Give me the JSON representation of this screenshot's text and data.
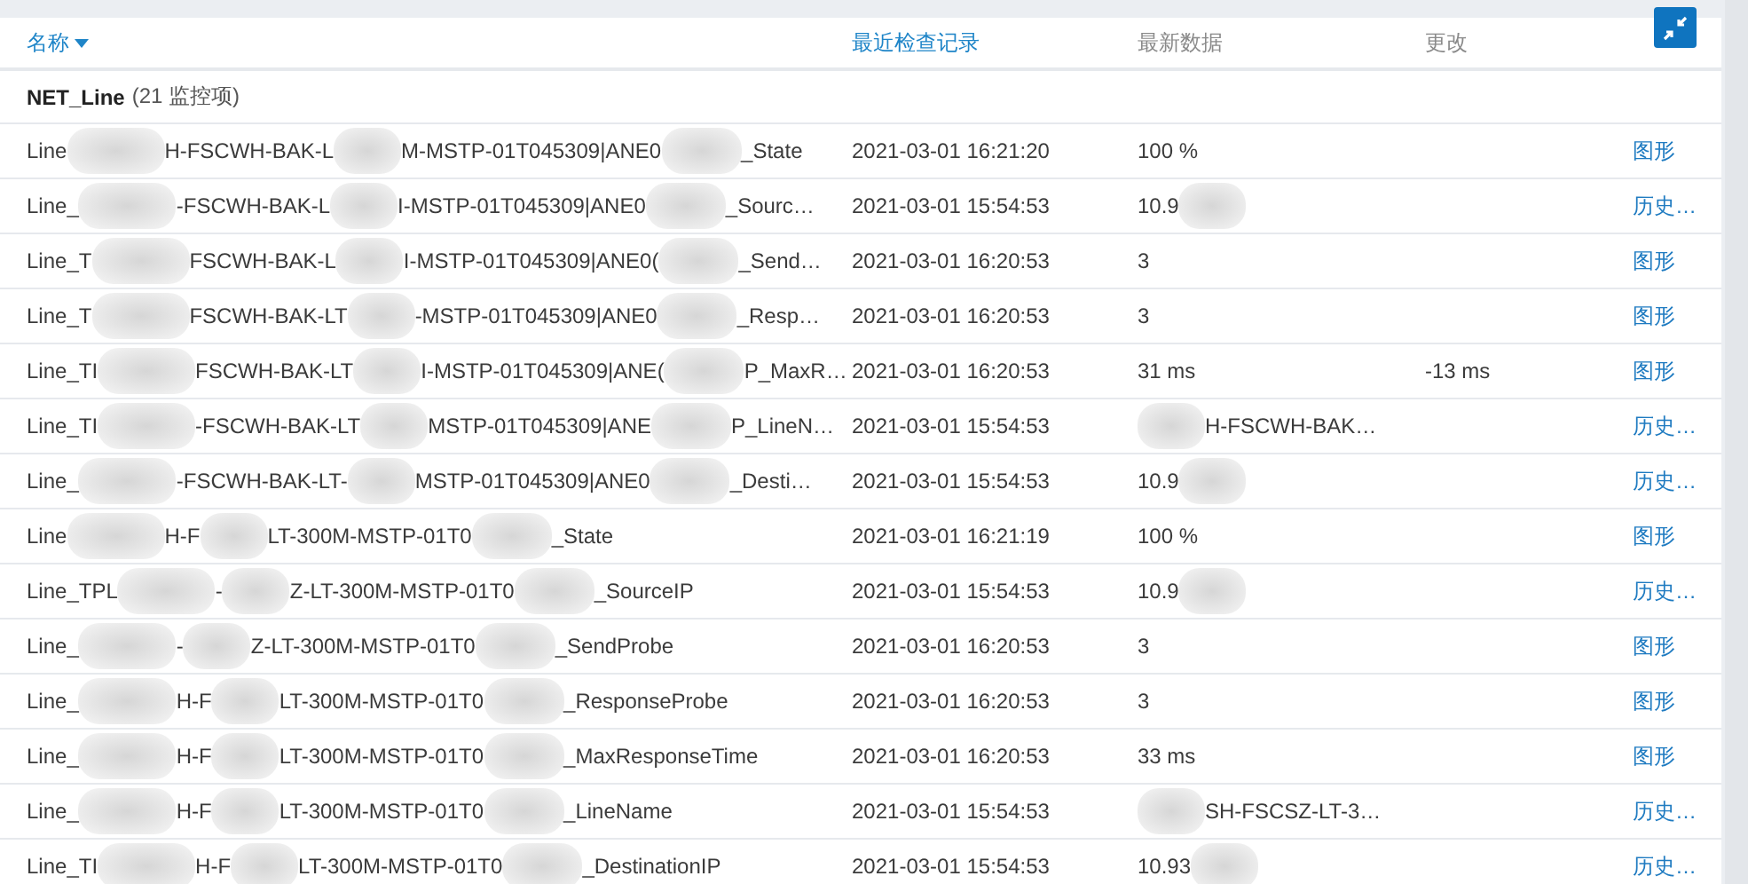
{
  "columns": [
    {
      "label": "名称",
      "link": true,
      "sorted": true
    },
    {
      "label": "最近检查记录",
      "link": true,
      "sorted": false
    },
    {
      "label": "最新数据",
      "link": false,
      "sorted": false
    },
    {
      "label": "更改",
      "link": false,
      "sorted": false
    }
  ],
  "group": {
    "name": "NET_Line",
    "count": "(21 监控项)"
  },
  "rows": [
    {
      "name": [
        "Line",
        "H-FSCWH-BAK-L",
        "M-MSTP-01T045309|ANE0",
        "_State"
      ],
      "last_check": "2021-03-01 16:21:20",
      "data": [
        {
          "kind": "text",
          "text": "100 %"
        }
      ],
      "link": "图形"
    },
    {
      "name": [
        "Line_",
        "-FSCWH-BAK-L",
        "I-MSTP-01T045309|ANE0",
        "_Sourc…"
      ],
      "last_check": "2021-03-01 15:54:53",
      "data": [
        {
          "kind": "text",
          "text": "10.9"
        },
        {
          "kind": "blur"
        }
      ],
      "link": "历史…"
    },
    {
      "name": [
        "Line_T",
        "FSCWH-BAK-L",
        "I-MSTP-01T045309|ANE0(",
        "_Send…"
      ],
      "last_check": "2021-03-01 16:20:53",
      "data": [
        {
          "kind": "text",
          "text": "3"
        }
      ],
      "link": "图形"
    },
    {
      "name": [
        "Line_T",
        "FSCWH-BAK-LT",
        "-MSTP-01T045309|ANE0",
        "_Resp…"
      ],
      "last_check": "2021-03-01 16:20:53",
      "data": [
        {
          "kind": "text",
          "text": "3"
        }
      ],
      "link": "图形"
    },
    {
      "name": [
        "Line_TI",
        "FSCWH-BAK-LT",
        "I-MSTP-01T045309|ANE(",
        "P_MaxR…"
      ],
      "last_check": "2021-03-01 16:20:53",
      "data": [
        {
          "kind": "text",
          "text": "31 ms"
        }
      ],
      "change": "-13 ms",
      "link": "图形"
    },
    {
      "name": [
        "Line_TI",
        "-FSCWH-BAK-LT",
        "MSTP-01T045309|ANE",
        "P_LineN…"
      ],
      "last_check": "2021-03-01 15:54:53",
      "data": [
        {
          "kind": "blur"
        },
        {
          "kind": "text",
          "text": "H-FSCWH-BAK…"
        }
      ],
      "link": "历史…"
    },
    {
      "name": [
        "Line_",
        "-FSCWH-BAK-LT-",
        "MSTP-01T045309|ANE0",
        "_Desti…"
      ],
      "last_check": "2021-03-01 15:54:53",
      "data": [
        {
          "kind": "text",
          "text": "10.9"
        },
        {
          "kind": "blur"
        }
      ],
      "link": "历史…"
    },
    {
      "name": [
        "Line",
        "H-F",
        "LT-300M-MSTP-01T0",
        "_State"
      ],
      "last_check": "2021-03-01 16:21:19",
      "data": [
        {
          "kind": "text",
          "text": "100 %"
        }
      ],
      "link": "图形"
    },
    {
      "name": [
        "Line_TPL",
        "-",
        "Z-LT-300M-MSTP-01T0",
        "_SourceIP"
      ],
      "last_check": "2021-03-01 15:54:53",
      "data": [
        {
          "kind": "text",
          "text": "10.9"
        },
        {
          "kind": "blur"
        }
      ],
      "link": "历史…"
    },
    {
      "name": [
        "Line_",
        "-",
        "Z-LT-300M-MSTP-01T0",
        "_SendProbe"
      ],
      "last_check": "2021-03-01 16:20:53",
      "data": [
        {
          "kind": "text",
          "text": "3"
        }
      ],
      "link": "图形"
    },
    {
      "name": [
        "Line_",
        "H-F",
        "LT-300M-MSTP-01T0",
        "_ResponseProbe"
      ],
      "last_check": "2021-03-01 16:20:53",
      "data": [
        {
          "kind": "text",
          "text": "3"
        }
      ],
      "link": "图形"
    },
    {
      "name": [
        "Line_",
        "H-F",
        "LT-300M-MSTP-01T0",
        "_MaxResponseTime"
      ],
      "last_check": "2021-03-01 16:20:53",
      "data": [
        {
          "kind": "text",
          "text": "33 ms"
        }
      ],
      "link": "图形"
    },
    {
      "name": [
        "Line_",
        "H-F",
        "LT-300M-MSTP-01T0",
        "_LineName"
      ],
      "last_check": "2021-03-01 15:54:53",
      "data": [
        {
          "kind": "blur"
        },
        {
          "kind": "text",
          "text": "SH-FSCSZ-LT-3…"
        }
      ],
      "link": "历史…"
    },
    {
      "name": [
        "Line_TI",
        "H-F",
        "LT-300M-MSTP-01T0",
        "_DestinationIP"
      ],
      "last_check": "2021-03-01 15:54:53",
      "data": [
        {
          "kind": "text",
          "text": "10.93"
        },
        {
          "kind": "blur"
        }
      ],
      "link": "历史…"
    }
  ]
}
